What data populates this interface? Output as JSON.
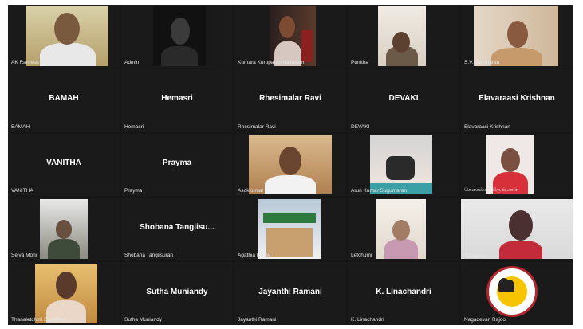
{
  "meeting": {
    "participants": [
      {
        "label": "AK Ramesh",
        "center_name": "",
        "video": true
      },
      {
        "label": "Admin",
        "center_name": "",
        "video": true
      },
      {
        "label": "Kumara Kuruparan Kailasam",
        "center_name": "",
        "video": true
      },
      {
        "label": "Punitha",
        "center_name": "",
        "video": true
      },
      {
        "label": "S.V.Manimaran",
        "center_name": "",
        "video": true
      },
      {
        "label": "BAMAH",
        "center_name": "BAMAH",
        "video": false
      },
      {
        "label": "Hemasri",
        "center_name": "Hemasri",
        "video": false
      },
      {
        "label": "Rhesimalar Ravi",
        "center_name": "Rhesimalar Ravi",
        "video": false
      },
      {
        "label": "DEVAKI",
        "center_name": "DEVAKI",
        "video": false
      },
      {
        "label": "Elavaraasi Krishnan",
        "center_name": "Elavaraasi Krishnan",
        "video": false
      },
      {
        "label": "VANITHA",
        "center_name": "VANITHA",
        "video": false
      },
      {
        "label": "Prayma",
        "center_name": "Prayma",
        "video": false
      },
      {
        "label": "Asokkumar",
        "center_name": "",
        "video": true
      },
      {
        "label": "Arun Kumar Sugumaran",
        "center_name": "",
        "video": true
      },
      {
        "label": "கௌசல்யா கிருஷ்ணன்",
        "center_name": "",
        "video": true
      },
      {
        "label": "Selva Moni",
        "center_name": "",
        "video": true
      },
      {
        "label": "Shobana Tangiisuran",
        "center_name": "Shobana  Tangiisu...",
        "video": false
      },
      {
        "label": "Agathia Rathy",
        "center_name": "",
        "video": true
      },
      {
        "label": "Letchumi",
        "center_name": "",
        "video": true
      },
      {
        "label": "Sivagami",
        "center_name": "",
        "video": true
      },
      {
        "label": "Thanaletchmi Sinnathiri",
        "center_name": "",
        "video": true
      },
      {
        "label": "Sutha Muniandy",
        "center_name": "Sutha Muniandy",
        "video": false
      },
      {
        "label": "Jayanthi Ramani",
        "center_name": "Jayanthi Ramani",
        "video": false
      },
      {
        "label": "K. Linachandri",
        "center_name": "K. Linachandri",
        "video": false
      },
      {
        "label": "Nagadevan Rajoo",
        "center_name": "",
        "video": true
      }
    ]
  }
}
